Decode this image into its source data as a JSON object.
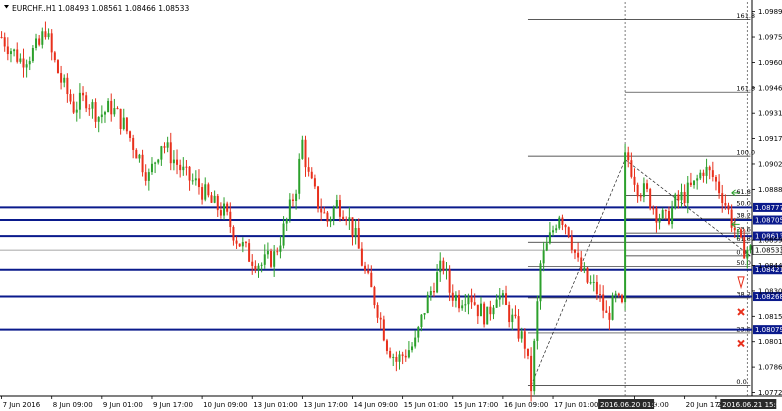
{
  "header": {
    "symbol": "EURCHF..H1",
    "ohlc": "1.08493 1.08561 1.08466 1.08533"
  },
  "price_axis": [
    {
      "value": 1.0772,
      "label": "1.07720"
    },
    {
      "value": 1.07865,
      "label": "1.07865"
    },
    {
      "value": 1.0801,
      "label": "1.08010"
    },
    {
      "value": 1.08155,
      "label": "1.08155"
    },
    {
      "value": 1.083,
      "label": "1.08300"
    },
    {
      "value": 1.08445,
      "label": "1.08445"
    },
    {
      "value": 1.0859,
      "label": "1.08590"
    },
    {
      "value": 1.0888,
      "label": "1.08880"
    },
    {
      "value": 1.09025,
      "label": "1.09025"
    },
    {
      "value": 1.0917,
      "label": "1.09170"
    },
    {
      "value": 1.09315,
      "label": "1.09315"
    },
    {
      "value": 1.0946,
      "label": "1.09460"
    },
    {
      "value": 1.09605,
      "label": "1.09605"
    },
    {
      "value": 1.0975,
      "label": "1.09750"
    },
    {
      "value": 1.09895,
      "label": "1.09895"
    }
  ],
  "time_axis": [
    {
      "label": "7 Jun 2016",
      "bar": 0
    },
    {
      "label": "8 Jun 09:00",
      "bar": 16
    },
    {
      "label": "9 Jun 01:00",
      "bar": 32
    },
    {
      "label": "9 Jun 17:00",
      "bar": 48
    },
    {
      "label": "10 Jun 09:00",
      "bar": 64
    },
    {
      "label": "13 Jun 01:00",
      "bar": 80
    },
    {
      "label": "13 Jun 17:00",
      "bar": 96
    },
    {
      "label": "14 Jun 09:00",
      "bar": 112
    },
    {
      "label": "15 Jun 01:00",
      "bar": 128
    },
    {
      "label": "15 Jun 17:00",
      "bar": 144
    },
    {
      "label": "16 Jun 09:00",
      "bar": 160
    },
    {
      "label": "17 Jun 01:00",
      "bar": 176
    },
    {
      "label": "Jun 09:00",
      "bar": 202
    },
    {
      "label": "20 Jun 17:00",
      "bar": 218
    },
    {
      "label": "21 J",
      "bar": 228
    }
  ],
  "time_highlights": [
    {
      "label": "2016.06.20 01:00",
      "bar": 199
    },
    {
      "label": "2016.06.21 15:00",
      "bar": 238
    }
  ],
  "horizontal_levels": [
    {
      "value": 1.08777,
      "label": "1.08777",
      "highlight": true
    },
    {
      "value": 1.08705,
      "label": "1.08705",
      "highlight": true
    },
    {
      "value": 1.08613,
      "label": "1.08613",
      "highlight": true
    },
    {
      "value": 1.08533,
      "label": "1.08533",
      "highlight": false
    },
    {
      "value": 1.08421,
      "label": "1.08421",
      "highlight": true
    },
    {
      "value": 1.08268,
      "label": "1.08268",
      "highlight": true
    },
    {
      "value": 1.08079,
      "label": "1.08079",
      "highlight": true
    }
  ],
  "fib_levels": [
    {
      "value": 1.0985,
      "label": "161.8",
      "left_bar": 168
    },
    {
      "value": 1.09435,
      "label": "161.8",
      "left_bar": 199
    },
    {
      "value": 1.0907,
      "label": "100.0",
      "left_bar": 168
    },
    {
      "value": 1.08845,
      "label": "61.8",
      "left_bar": 199
    },
    {
      "value": 1.08778,
      "label": "50.0",
      "left_bar": 168
    },
    {
      "value": 1.08712,
      "label": "38.2",
      "left_bar": 199
    },
    {
      "value": 1.0863,
      "label": "23.6",
      "left_bar": 199
    },
    {
      "value": 1.08578,
      "label": "61.8",
      "left_bar": 168
    },
    {
      "value": 1.085,
      "label": "0.0",
      "left_bar": 199
    },
    {
      "value": 1.0844,
      "label": "50.0",
      "left_bar": 168
    },
    {
      "value": 1.0826,
      "label": "38.2",
      "left_bar": 168
    },
    {
      "value": 1.0806,
      "label": "23.6",
      "left_bar": 168
    },
    {
      "value": 1.0776,
      "label": "0.0",
      "left_bar": 168
    }
  ],
  "colors": {
    "up": "#2ca02c",
    "down": "#e8301c",
    "level": "#0a1a8c",
    "label_bg": "#0a1a8c",
    "grid": "#000000"
  },
  "chart_data": {
    "type": "candlestick",
    "symbol": "EURCHF..H1",
    "ylim": [
      1.077,
      1.0995
    ],
    "bar_count": 240,
    "keypoints": [
      [
        0,
        1.0975
      ],
      [
        3,
        1.0968
      ],
      [
        6,
        1.0962
      ],
      [
        9,
        1.0965
      ],
      [
        12,
        1.097
      ],
      [
        14,
        1.098
      ],
      [
        16,
        1.0965
      ],
      [
        19,
        1.095
      ],
      [
        23,
        1.0935
      ],
      [
        27,
        1.094
      ],
      [
        31,
        1.093
      ],
      [
        35,
        1.0935
      ],
      [
        39,
        1.0925
      ],
      [
        43,
        1.091
      ],
      [
        47,
        1.0895
      ],
      [
        51,
        1.0915
      ],
      [
        55,
        1.0905
      ],
      [
        59,
        1.0895
      ],
      [
        63,
        1.089
      ],
      [
        67,
        1.088
      ],
      [
        71,
        1.0875
      ],
      [
        75,
        1.086
      ],
      [
        79,
        1.085
      ],
      [
        83,
        1.0845
      ],
      [
        87,
        1.085
      ],
      [
        91,
        1.087
      ],
      [
        94,
        1.089
      ],
      [
        96,
        1.0915
      ],
      [
        98,
        1.0895
      ],
      [
        101,
        1.088
      ],
      [
        104,
        1.087
      ],
      [
        107,
        1.088
      ],
      [
        110,
        1.0875
      ],
      [
        113,
        1.086
      ],
      [
        116,
        1.084
      ],
      [
        120,
        1.082
      ],
      [
        123,
        1.08
      ],
      [
        126,
        1.079
      ],
      [
        129,
        1.0795
      ],
      [
        132,
        1.08
      ],
      [
        135,
        1.082
      ],
      [
        138,
        1.0835
      ],
      [
        141,
        1.0845
      ],
      [
        143,
        1.083
      ],
      [
        146,
        1.0825
      ],
      [
        149,
        1.083
      ],
      [
        152,
        1.082
      ],
      [
        155,
        1.0815
      ],
      [
        158,
        1.083
      ],
      [
        161,
        1.082
      ],
      [
        164,
        1.081
      ],
      [
        167,
        1.08
      ],
      [
        169,
        1.0775
      ],
      [
        172,
        1.0845
      ],
      [
        175,
        1.086
      ],
      [
        178,
        1.0875
      ],
      [
        181,
        1.0865
      ],
      [
        184,
        1.0845
      ],
      [
        187,
        1.0835
      ],
      [
        190,
        1.083
      ],
      [
        193,
        1.0815
      ],
      [
        196,
        1.0825
      ],
      [
        198,
        1.082
      ]
    ],
    "right_keypoints": [
      [
        200,
        1.0905
      ],
      [
        203,
        1.089
      ],
      [
        206,
        1.0885
      ],
      [
        209,
        1.0875
      ],
      [
        212,
        1.087
      ],
      [
        215,
        1.088
      ],
      [
        218,
        1.0885
      ],
      [
        221,
        1.089
      ],
      [
        224,
        1.09
      ],
      [
        227,
        1.0895
      ],
      [
        230,
        1.0885
      ],
      [
        233,
        1.087
      ],
      [
        236,
        1.0855
      ],
      [
        239,
        1.0853
      ]
    ]
  }
}
